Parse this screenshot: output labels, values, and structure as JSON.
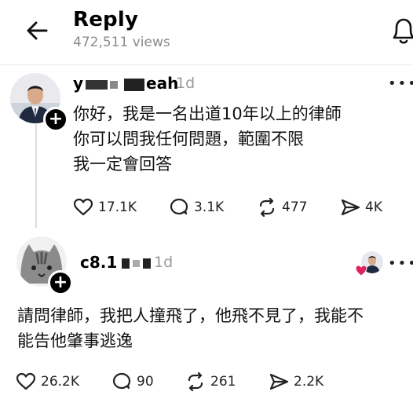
{
  "header": {
    "title": "Reply",
    "views": "472,511 views"
  },
  "post1": {
    "username_start": "y",
    "username_end": "eah",
    "time": "1d",
    "text": "你好，我是一名出道10年以上的律師\n你可以問我任何問題，範圍不限\n我一定會回答",
    "actions": {
      "likes": "17.1K",
      "replies": "3.1K",
      "reposts": "477",
      "shares": "4K"
    }
  },
  "post2": {
    "username_start": "c8.1",
    "time": "1d",
    "text": "請問律師，我把人撞飛了，他飛不見了，我能不\n能告他肇事逃逸",
    "actions": {
      "likes": "26.2K",
      "replies": "90",
      "reposts": "261",
      "shares": "2.2K"
    }
  },
  "ui": {
    "more": "•••",
    "plus": "+"
  },
  "colors": {
    "accent_red": "#e0245e",
    "muted": "#9a9a9a"
  }
}
